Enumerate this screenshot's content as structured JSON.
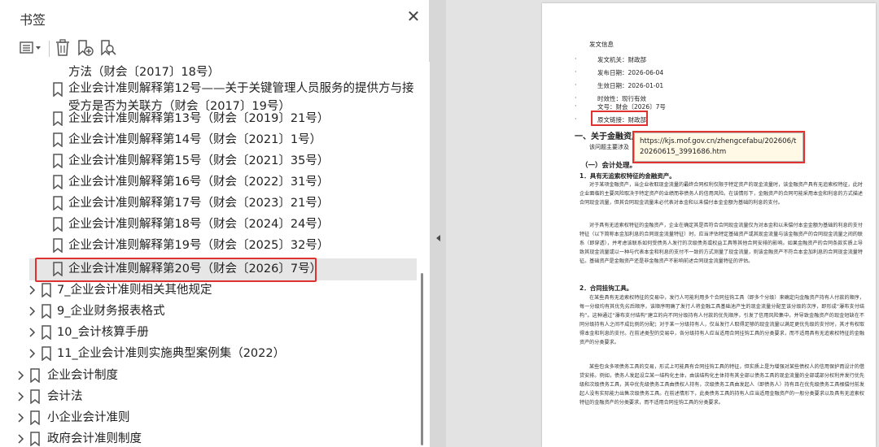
{
  "panel": {
    "title": "书签",
    "close_glyph": "✕"
  },
  "toolbar": {
    "options_icon": "list-options-icon",
    "delete_icon": "trash-icon",
    "new_bookmark_icon": "add-bookmark-icon",
    "find_bookmark_icon": "find-bookmark-icon"
  },
  "bookmarks": {
    "items": [
      {
        "label": "方法（财会〔2017〕18号）"
      },
      {
        "label": "企业会计准则解释第12号——关于关键管理人员服务的提供方与接受方是否为关联方（财会〔2017〕19号）"
      },
      {
        "label": "企业会计准则解释第13号（财会〔2019〕21号）"
      },
      {
        "label": "企业会计准则解释第14号（财会〔2021〕1号）"
      },
      {
        "label": "企业会计准则解释第15号（财会〔2021〕35号）"
      },
      {
        "label": "企业会计准则解释第16号（财会〔2022〕31号）"
      },
      {
        "label": "企业会计准则解释第17号（财会〔2023〕21号）"
      },
      {
        "label": "企业会计准则解释第18号（财会〔2024〕24号）"
      },
      {
        "label": "企业会计准则解释第19号（财会〔2025〕32号）"
      },
      {
        "label": "企业会计准则解释第20号（财会〔2026〕7号）"
      },
      {
        "label": "7_企业会计准则相关其他规定"
      },
      {
        "label": "9_企业财务报表格式"
      },
      {
        "label": "10_会计核算手册"
      },
      {
        "label": "11_企业会计准则实施典型案例集（2022）"
      },
      {
        "label": "企业会计制度"
      },
      {
        "label": "会计法"
      },
      {
        "label": "小企业会计准则"
      },
      {
        "label": "政府会计准则制度"
      }
    ]
  },
  "document": {
    "meta_title": "发文信息",
    "meta": [
      {
        "label": "发文机关：财政部"
      },
      {
        "label": "发布日期：2026-06-04"
      },
      {
        "label": "生效日期：2026-01-01"
      },
      {
        "label": "时效性：现行有效"
      },
      {
        "label": "文号：财会〔2026〕7号"
      },
      {
        "label": "原文链接：财政部"
      }
    ],
    "section1": "一、关于金融资产合同现金流量特征评估",
    "section1_sub": "该问题主要涉及",
    "section2": "（一）会计处理。",
    "heading1": "1．具有无追索权特征的金融资产。",
    "para1": "对于某项金融资产，当企业收取现金流量的最终合同权利仅限于特定资产的现金流量时，该金融资产具有无追索权特征，此时企业面临的主要风险取决于特定资产的业绩而非债务人的信用风险。在该情形下，金融资产的合同可能采用本金和利息的方式描述合同现金流量，但其合同现金流量未必代表对本金和以未偿付本金金额为基础的利息的支付。",
    "para2": "对于具有无追索权特征的金融资产，企业在确定其是否符合合同现金流量仅为对本金和以未偿付本金金额为基础的利息的支付特征（以下简称本金加利息的合同现金流量特征）时，应当评估特定基础资产或其现金流量与该金融资产的合同现金流量之间的联系（即穿透），并考虑该联系如何受债务人发行的次级债务或权益工具等其他合同安排的影响。如果金融资产的合同条款实质上导致其现金流量或以一种与代表本金和利息的支付不一致的方式测量了现金流量，则该金融资产不符合本金加利息的合同现金流量特征。基础资产是金融资产还是非金融资产不影响前述合同现金流量特征的评估。",
    "heading2": "2．合同挂钩工具。",
    "para3": "在某些具有无追索权特征的交易中，发行人可能利用多个合同挂钩工具（即多个分级）来确定向金融资产持有人付款的顺序，每一分级均有其优先劣后顺序，该顺序明确了发行人将金融工具基础池产生的现金流量分配至该分级的次序，即形成“瀑布支付结构”。这种通过“瀑布支付结构”建立的向不同分级持有人付款的优先顺序，引发了信用风险集中，并导致金融资产的现金短缺在不同分级持有人之间不成比例的分配；对于某一分级持有人，仅当发行人取得足够的现金流量以满足更优先级的支付时，其才有权取得本金和利息的支付。在前述类型的交易中，各分级持有人应当适用合同挂钩工具的分类要求，而不适用具有无追索权特征的金融资产的分类要求。",
    "para4": "某些包含多项债务工具的交易，形式上可能具有合同挂钩工具的特征，但实质上是为增强对某些债权人的信用保护而设计的借贷安排。例如，债务人发起设立某一结构化主体，由该结构化主体持有其全部以债务工具的现金流量的全部或部分权利并发行优先级和次级债务工具，其中优先级债务工具由债权人持有，次级债务工具由发起人（即债务人）持有且在优先级债务工具根偿付前发起人没有实际能力出售次级债务工具。在前述情形下，此类债务工具的持有人应当适用金融资产的一般分类要求以及具有无追索权特征的金融资产的分类要求，而不适用合同挂钩工具的分类要求。",
    "tooltip_url": "https://kjs.mof.gov.cn/zhengcefabu/202606/t20260615_3991686.htm"
  }
}
